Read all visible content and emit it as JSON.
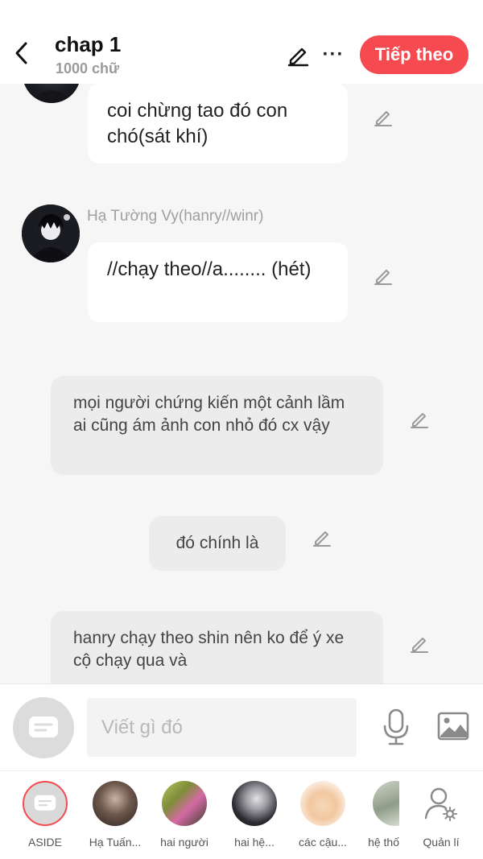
{
  "header": {
    "title": "chap 1",
    "subtitle": "1000 chữ",
    "next_label": "Tiếp theo",
    "more_label": "···"
  },
  "messages": [
    {
      "type": "character",
      "speaker": "",
      "text": "coi chừng tao đó con chó(sát khí)"
    },
    {
      "type": "character",
      "speaker": "Hạ Tường Vy(hanry//winr)",
      "text": "//chạy theo//a........ (hét)"
    },
    {
      "type": "narration",
      "text": "mọi người chứng kiến một cảnh lầm ai cũng ám ảnh con nhỏ đó cx vậy"
    },
    {
      "type": "narration",
      "text": "đó chính là"
    },
    {
      "type": "narration",
      "text": "hanry chạy theo shin nên ko để ý xe cộ chạy qua và"
    }
  ],
  "input": {
    "placeholder": "Viết gì đó"
  },
  "characters": [
    {
      "label": "ASIDE"
    },
    {
      "label": "Hạ Tuấn..."
    },
    {
      "label": "hai người"
    },
    {
      "label": "hai hệ..."
    },
    {
      "label": "các cậu..."
    },
    {
      "label": "hệ thố"
    },
    {
      "label": "Quản lí"
    }
  ],
  "colors": {
    "accent": "#f44a50",
    "background": "#f6f6f6",
    "bubble_white": "#ffffff",
    "bubble_grey": "#ececec"
  }
}
